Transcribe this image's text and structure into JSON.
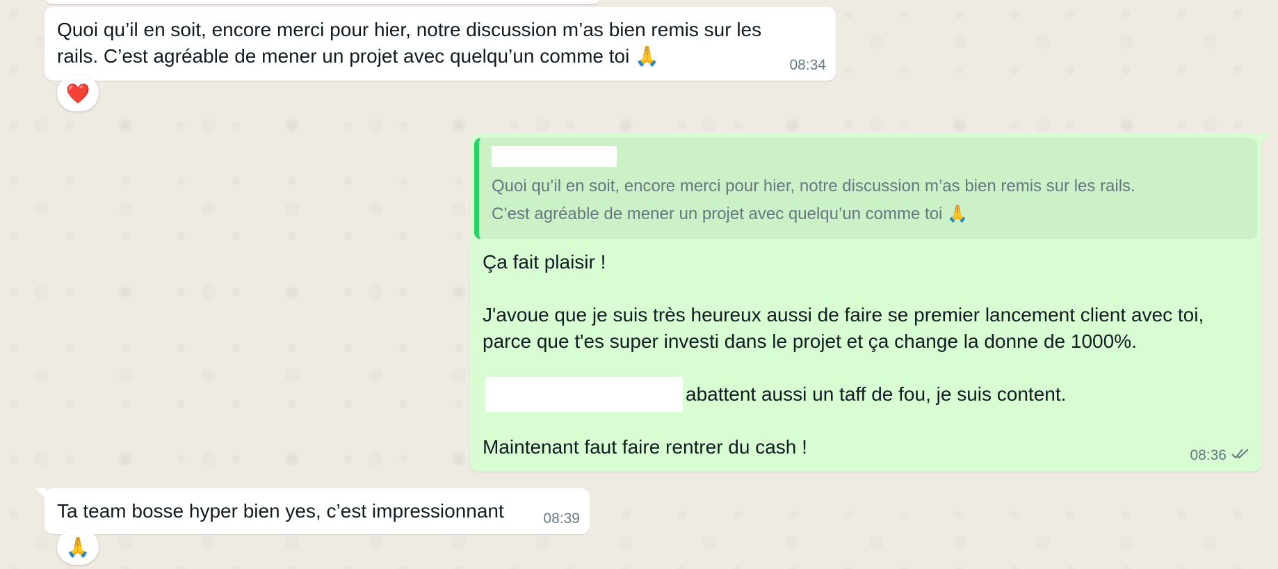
{
  "messages": [
    {
      "direction": "incoming",
      "text": "Quoi qu’il en soit, encore merci pour hier, notre discussion m’as bien remis sur les\nrails. C’est agréable de mener un projet avec quelqu’un comme toi 🙏",
      "time": "08:34",
      "reaction": "❤️"
    },
    {
      "direction": "outgoing",
      "quoted": {
        "text": "Quoi qu’il en soit, encore merci pour hier, notre discussion m’as bien remis sur les rails.\nC’est agréable de mener un projet avec quelqu’un comme toi 🙏"
      },
      "paragraphs": [
        "Ça fait plaisir !",
        "J'avoue que je suis très heureux aussi de faire se premier lancement client avec toi,\nparce que t'es super investi dans le projet et ça change la donne de 1000%.",
        "abattent aussi un taff de fou, je suis content.",
        "Maintenant faut faire rentrer du cash !"
      ],
      "time": "08:36",
      "status_icon": "double-check-icon"
    },
    {
      "direction": "incoming",
      "text": "Ta team bosse hyper bien yes, c’est impressionnant",
      "time": "08:39",
      "reaction": "🙏"
    }
  ],
  "colors": {
    "background": "#efeae2",
    "incoming_bubble": "#ffffff",
    "outgoing_bubble": "#d9fdd3",
    "quote_bar": "#25d366",
    "meta_text": "#667781"
  }
}
